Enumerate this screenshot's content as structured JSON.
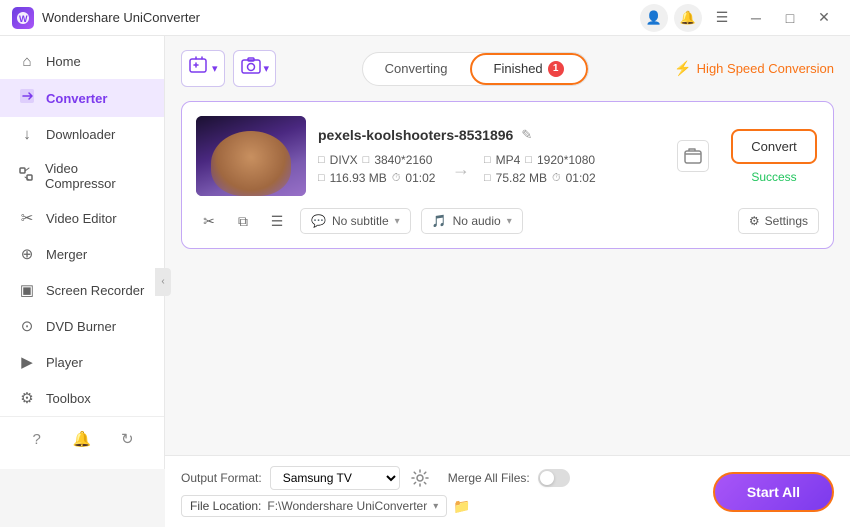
{
  "titlebar": {
    "app_name": "Wondershare UniConverter",
    "logo_letter": "W",
    "controls": [
      "minimize",
      "maximize",
      "close"
    ]
  },
  "header_icons": {
    "user_icon": "👤",
    "bell_icon": "🔔",
    "menu_icon": "☰"
  },
  "sidebar": {
    "items": [
      {
        "id": "home",
        "label": "Home",
        "icon": "⌂"
      },
      {
        "id": "converter",
        "label": "Converter",
        "icon": "⇄",
        "active": true
      },
      {
        "id": "downloader",
        "label": "Downloader",
        "icon": "↓"
      },
      {
        "id": "video-compressor",
        "label": "Video Compressor",
        "icon": "⧖"
      },
      {
        "id": "video-editor",
        "label": "Video Editor",
        "icon": "✂"
      },
      {
        "id": "merger",
        "label": "Merger",
        "icon": "⊕"
      },
      {
        "id": "screen-recorder",
        "label": "Screen Recorder",
        "icon": "▣"
      },
      {
        "id": "dvd-burner",
        "label": "DVD Burner",
        "icon": "⊙"
      },
      {
        "id": "player",
        "label": "Player",
        "icon": "▶"
      },
      {
        "id": "toolbox",
        "label": "Toolbox",
        "icon": "⚙"
      }
    ],
    "bottom_icons": [
      "?",
      "🔔",
      "↻"
    ]
  },
  "toolbar": {
    "add_file_label": "Add Files",
    "add_btn_icon": "+",
    "camera_icon": "📷",
    "tabs": [
      {
        "id": "converting",
        "label": "Converting",
        "active": false
      },
      {
        "id": "finished",
        "label": "Finished",
        "active": true,
        "badge": "1"
      }
    ],
    "high_speed_label": "High Speed Conversion",
    "high_speed_icon": "⚡"
  },
  "file_card": {
    "filename": "pexels-koolshooters-8531896",
    "edit_icon": "✎",
    "source": {
      "format": "DIVX",
      "resolution": "3840*2160",
      "size": "116.93 MB",
      "duration": "01:02"
    },
    "target": {
      "format": "MP4",
      "resolution": "1920*1080",
      "size": "75.82 MB",
      "duration": "01:02"
    },
    "arrow": "→",
    "action_icons": [
      "⊙"
    ],
    "convert_btn_label": "Convert",
    "success_label": "Success",
    "bottom": {
      "cut_icon": "✂",
      "copy_icon": "⧉",
      "list_icon": "☰",
      "subtitle_label": "No subtitle",
      "audio_label": "No audio",
      "settings_label": "Settings",
      "settings_icon": "⚙"
    }
  },
  "bottom_bar": {
    "output_format_label": "Output Format:",
    "format_value": "Samsung TV",
    "merge_label": "Merge All Files:",
    "file_location_label": "File Location:",
    "file_location_path": "F:\\Wondershare UniConverter",
    "start_all_label": "Start All"
  }
}
